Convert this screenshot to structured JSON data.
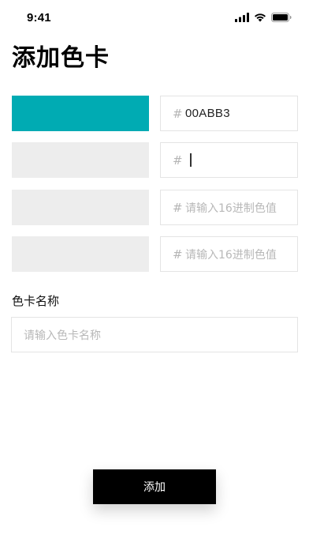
{
  "status_bar": {
    "time": "9:41",
    "icons": [
      "signal-icon",
      "wifi-icon",
      "battery-icon"
    ]
  },
  "page": {
    "title": "添加色卡"
  },
  "colors": {
    "hash_symbol": "#",
    "rows": [
      {
        "swatch_color": "#00ABB3",
        "value": "00ABB3",
        "placeholder": "",
        "focused": false
      },
      {
        "swatch_color": "#EDEDED",
        "value": "",
        "placeholder": "",
        "focused": true
      },
      {
        "swatch_color": "#EDEDED",
        "value": "",
        "placeholder": "请输入16进制色值",
        "focused": false
      },
      {
        "swatch_color": "#EDEDED",
        "value": "",
        "placeholder": "请输入16进制色值",
        "focused": false
      }
    ]
  },
  "name_section": {
    "label": "色卡名称",
    "placeholder": "请输入色卡名称",
    "value": ""
  },
  "actions": {
    "add_label": "添加"
  },
  "theme": {
    "accent": "#00ABB3",
    "button_bg": "#000000",
    "empty_swatch": "#EDEDED"
  }
}
